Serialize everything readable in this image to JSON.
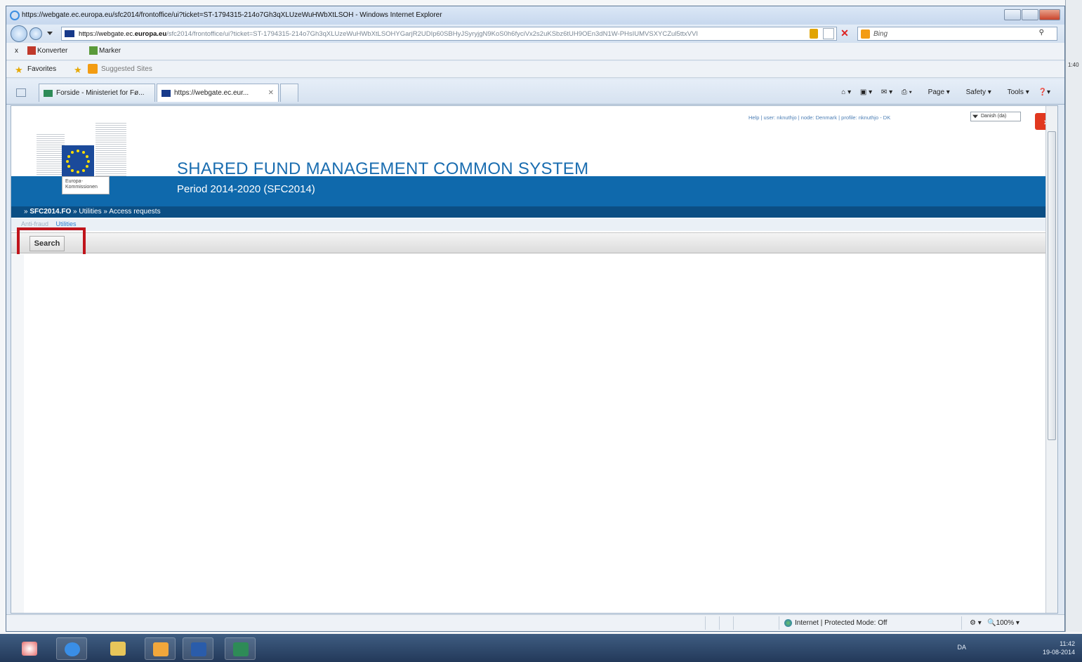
{
  "window": {
    "title": "https://webgate.ec.europa.eu/sfc2014/frontoffice/ui?ticket=ST-1794315-214o7Gh3qXLUzeWuHWbXtLSOH - Windows Internet Explorer"
  },
  "address_bar": {
    "prefix": "https://webgate.ec.",
    "domain": "europa.eu",
    "path": "/sfc2014/frontoffice/ui?ticket=ST-1794315-214o7Gh3qXLUzeWuHWbXtLSOHYGarjR2UDIp60SBHyJSyryjgN9KoS0h6fyciVx2s2uKSbz6tUH9OEn3dN1W-PHsIUMVSXYCZul5ttxVVI",
    "search_placeholder": "Bing"
  },
  "link_bar": {
    "close": "x",
    "konverter": "Konverter",
    "marker": "Marker"
  },
  "favorites_bar": {
    "favorites": "Favorites",
    "suggested": "Suggested Sites"
  },
  "tabs": [
    {
      "label": "Forside - Ministeriet for Fø..."
    },
    {
      "label": "https://webgate.ec.eur..."
    }
  ],
  "command_bar": {
    "page": "Page",
    "safety": "Safety",
    "tools": "Tools"
  },
  "page": {
    "top_links": "Help | user: nknuthjo | node: Denmark | profile: nknuthjo - DK",
    "language": "Danish (da)",
    "exit_glyph": "›",
    "ec_caption": "Europa-\nKommissionen",
    "system_title": "SHARED FUND MANAGEMENT COMMON SYSTEM",
    "period": "Period 2014-2020 (SFC2014)",
    "breadcrumb": {
      "root": "SFC2014.FO",
      "level1": "Utilities",
      "level2": "Access requests",
      "sep": "»"
    },
    "subnav": {
      "anti_fraud": "Anti-fraud",
      "utilities": "Utilities"
    },
    "search_button": "Search"
  },
  "status_bar": {
    "zone": "Internet | Protected Mode: Off",
    "zoom": "100%"
  },
  "taskbar": {
    "lang": "DA",
    "time": "11:42",
    "date": "19-08-2014"
  },
  "desktop": {
    "side_time": "1:40"
  }
}
